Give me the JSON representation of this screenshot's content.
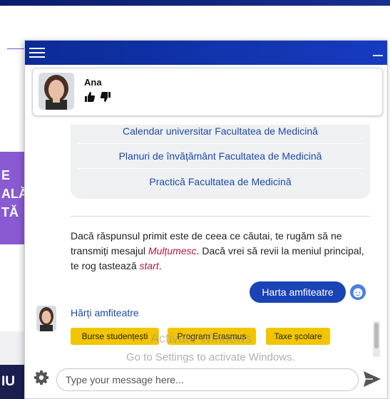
{
  "background": {
    "left_purple_text": "E\nALĂ\nTĂ",
    "left_navy_text": "IU"
  },
  "chat": {
    "agent": {
      "name": "Ana",
      "like_icon": "thumbs-up-icon",
      "dislike_icon": "thumbs-down-icon"
    },
    "options": [
      "Calendar universitar Facultatea de Medicină",
      "Planuri de învățământ Facultatea de Medicină",
      "Practică Facultatea de Medicină"
    ],
    "message": {
      "part1": "Dacă răspunsul primit este de ceea ce căutai, te rugăm să ne transmiți mesajul ",
      "highlight1": "Mulțumesc",
      "part2": ". Dacă vrei să revii la meniul principal, te rog tastează ",
      "highlight2": "start",
      "part3": "."
    },
    "user_message": "Harta amfiteatre",
    "bot_reply_link": "Hărți amfiteatre",
    "chips": [
      "Burse studențești",
      "Program Erasmus",
      "Taxe școlare"
    ],
    "watermark": {
      "title": "Activate Windows",
      "subtitle": "Go to Settings to activate Windows."
    },
    "input_placeholder": "Type your message here...",
    "colors": {
      "header": "#0b2b95",
      "accent": "#1a44b5",
      "chip": "#f2c500",
      "highlight": "#b5183f"
    }
  }
}
